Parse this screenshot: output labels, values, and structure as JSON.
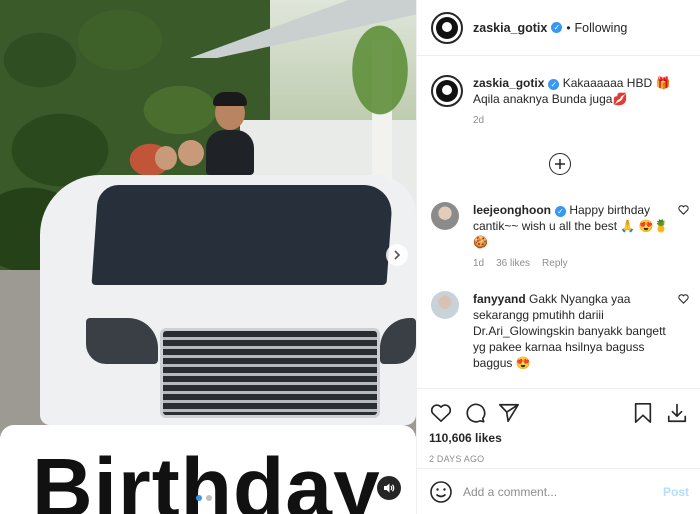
{
  "post": {
    "username": "zaskia_gotix",
    "follow_status": "Following",
    "separator": "•"
  },
  "caption": {
    "username": "zaskia_gotix",
    "text": "Kakaaaaaa HBD 🎁 Aqila anaknya Bunda juga💋",
    "age": "2d"
  },
  "comments": [
    {
      "username": "leejeonghoon",
      "text": "Happy birthday cantik~~ wish u all the best 🙏 😍🍍🍪",
      "age": "1d",
      "likes": "36 likes",
      "reply": "Reply"
    },
    {
      "username": "fanyyand",
      "text": "Gakk Nyangka yaa sekarangg pmutihh dariii Dr.Ari_Glowingskin banyakk bangett yg pakee karnaa hsilnya baguss baggus 😍"
    }
  ],
  "media": {
    "overlay_word": "Birthday"
  },
  "stats": {
    "likes": "110,606 likes",
    "date": "2 DAYS AGO"
  },
  "add_comment": {
    "placeholder": "Add a comment...",
    "post_label": "Post"
  },
  "colors": {
    "verified": "#3897f0",
    "muted": "#8e8e8e",
    "post_disabled": "#b2dffc",
    "text": "#262626"
  },
  "icons": {
    "load_more": "plus-circle-icon",
    "like": "heart-icon",
    "comment": "comment-icon",
    "share": "paper-plane-icon",
    "save": "bookmark-icon",
    "download": "download-icon",
    "emoji": "smiley-icon",
    "sound": "speaker-icon",
    "next": "chevron-right-icon"
  }
}
